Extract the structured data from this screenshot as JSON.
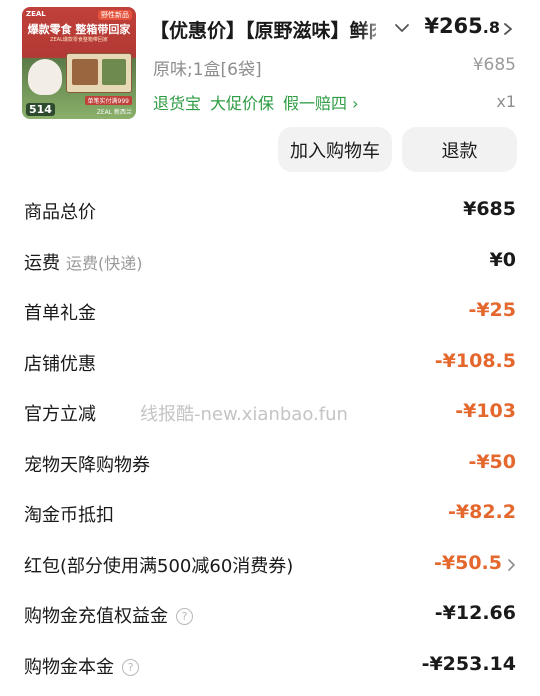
{
  "product": {
    "image_text": {
      "logo": "ZEAL",
      "badge": "野性新品",
      "headline": "爆款零食 整箱带回家",
      "subline": "ZEAL爆款零食整箱带回家",
      "price_tag": "514",
      "foot": "单笔实付满999",
      "foot2": "ZEAL 新西兰"
    },
    "title": "【优惠价】【原野滋味】鲜肉零食整箱",
    "price_main": "¥265",
    "price_decimal": ".8",
    "sku": "原味;1盒[6袋]",
    "original_price": "¥685",
    "services": [
      "退货宝",
      "大促价保",
      "假一赔四 ›"
    ],
    "quantity": "x1",
    "buttons": {
      "add_to_cart": "加入购物车",
      "refund": "退款"
    }
  },
  "summary_rows": [
    {
      "label": "商品总价",
      "note": "",
      "help": false,
      "value": "¥685",
      "color": "black",
      "arrow": false
    },
    {
      "label": "运费",
      "note": "运费(快递)",
      "help": false,
      "value": "¥0",
      "color": "black",
      "arrow": false
    },
    {
      "label": "首单礼金",
      "note": "",
      "help": false,
      "value": "-¥25",
      "color": "orange",
      "arrow": false
    },
    {
      "label": "店铺优惠",
      "note": "",
      "help": false,
      "value": "-¥108.5",
      "color": "orange",
      "arrow": false
    },
    {
      "label": "官方立减",
      "note": "",
      "help": false,
      "value": "-¥103",
      "color": "orange",
      "arrow": false
    },
    {
      "label": "宠物天降购物券",
      "note": "",
      "help": false,
      "value": "-¥50",
      "color": "orange",
      "arrow": false
    },
    {
      "label": "淘金币抵扣",
      "note": "",
      "help": false,
      "value": "-¥82.2",
      "color": "orange",
      "arrow": false
    },
    {
      "label": "红包(部分使用满500减60消费券)",
      "note": "",
      "help": false,
      "value": "-¥50.5",
      "color": "orange",
      "arrow": true
    },
    {
      "label": "购物金充值权益金",
      "note": "",
      "help": true,
      "value": "-¥12.66",
      "color": "black",
      "arrow": false
    },
    {
      "label": "购物金本金",
      "note": "",
      "help": true,
      "value": "-¥253.14",
      "color": "black",
      "arrow": false
    }
  ],
  "watermark": "线报酷-new.xianbao.fun",
  "colors": {
    "accent_orange": "#e4682d",
    "service_green": "#2e9c43",
    "button_bg": "#f2f2f2"
  }
}
